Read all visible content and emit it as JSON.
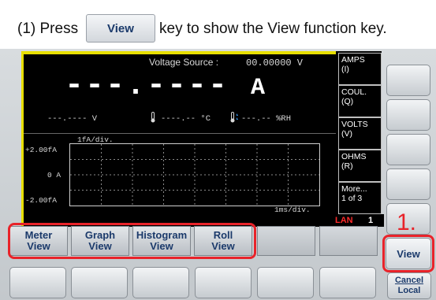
{
  "instruction": {
    "before": "(1) Press",
    "key_label": "View",
    "after": "key to show the View function key."
  },
  "display": {
    "voltage_source_label": "Voltage Source :",
    "voltage_source_value": "00.00000  V",
    "main_reading": "---.----",
    "main_unit": "A",
    "secondary_voltage": "---.----  V",
    "temperature": "----.-- °C",
    "humidity": "---.-- %RH",
    "graph": {
      "scale_label": "1fA/div.",
      "y_labels": [
        "+2.00fA",
        "0 A",
        "-2.00fA"
      ],
      "x_scale": "1ms/div."
    },
    "status": {
      "lan": "LAN",
      "lan_num": "1"
    },
    "menu": [
      {
        "line1": "AMPS",
        "line2": "(I)"
      },
      {
        "line1": "COUL.",
        "line2": "(Q)"
      },
      {
        "line1": "VOLTS",
        "line2": "(V)"
      },
      {
        "line1": "OHMS",
        "line2": "(R)"
      },
      {
        "line1": "More...",
        "line2": "1 of 3"
      }
    ]
  },
  "softkeys": [
    {
      "line1": "Meter",
      "line2": "View"
    },
    {
      "line1": "Graph",
      "line2": "View"
    },
    {
      "line1": "Histogram",
      "line2": "View"
    },
    {
      "line1": "Roll",
      "line2": "View"
    },
    {
      "line1": "",
      "line2": ""
    },
    {
      "line1": "",
      "line2": ""
    }
  ],
  "side_keys": {
    "view": "View",
    "cancel_line1": "Cancel",
    "cancel_line2": "Local"
  },
  "step_marker": "1.",
  "colors": {
    "accent_red": "#e8232a",
    "display_yellow": "#e8df00",
    "key_text": "#1b3a6b"
  }
}
